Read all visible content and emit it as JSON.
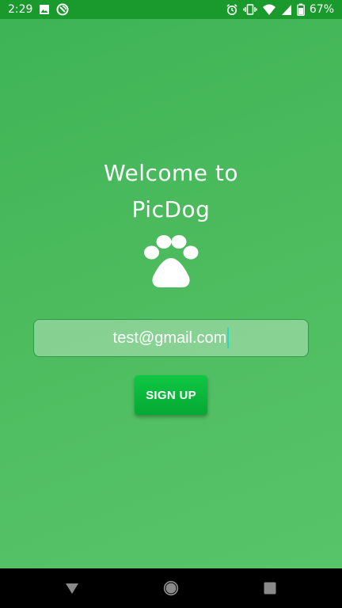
{
  "status_bar": {
    "time": "2:29",
    "battery_percent": "67%",
    "left_icons": [
      "image-icon",
      "sync-icon"
    ],
    "right_icons": [
      "alarm-icon",
      "vibrate-icon",
      "wifi-icon",
      "signal-icon",
      "battery-icon"
    ]
  },
  "welcome": {
    "line1": "Welcome to",
    "line2": "PicDog"
  },
  "logo": {
    "icon": "paw-icon"
  },
  "form": {
    "email_value": "test@gmail.com"
  },
  "signup": {
    "label": "SIGN UP"
  },
  "nav": {
    "buttons": [
      "back-icon",
      "home-icon",
      "recents-icon"
    ]
  },
  "colors": {
    "status_bar": "#1a9a2d",
    "background": "#4cbb5e",
    "button": "#05a833",
    "caret": "#2bd7c8"
  }
}
